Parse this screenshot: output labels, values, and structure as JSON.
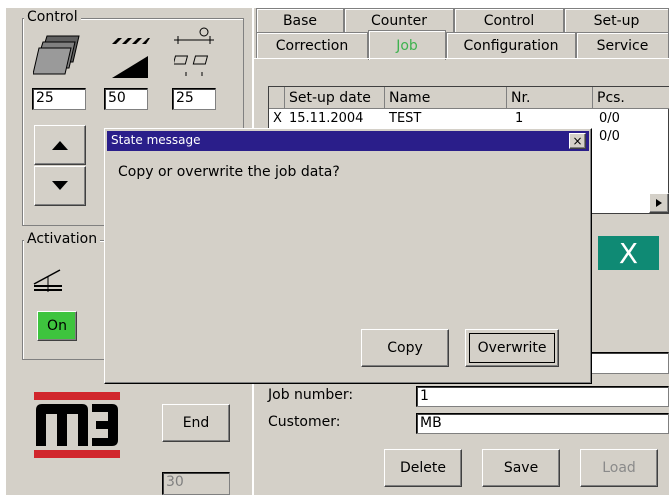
{
  "control": {
    "legend": "Control",
    "values": [
      "25",
      "50",
      "25"
    ]
  },
  "activation": {
    "legend": "Activation",
    "on_label": "On"
  },
  "buttons": {
    "end": "End",
    "counter_field": "30"
  },
  "tabs_row1": [
    "Base",
    "Counter",
    "Control",
    "Set-up"
  ],
  "tabs_row2": [
    "Correction",
    "Job",
    "Configuration",
    "Service"
  ],
  "job_table": {
    "headers": [
      "Set-up date",
      "Name",
      "Nr.",
      "Pcs."
    ],
    "rows": [
      {
        "mark": "X",
        "date": "15.11.2004",
        "name": "TEST",
        "nr": "1",
        "pcs": "0/0"
      },
      {
        "mark": "",
        "date": "",
        "name": "",
        "nr": "",
        "pcs": "0/0"
      }
    ]
  },
  "form": {
    "job_number_label": "Job number:",
    "job_number_value": "1",
    "customer_label": "Customer:",
    "customer_value": "MB"
  },
  "actions": {
    "delete": "Delete",
    "save": "Save",
    "load": "Load"
  },
  "dialog": {
    "title": "State message",
    "close": "×",
    "message": "Copy or overwrite the job data?",
    "copy": "Copy",
    "overwrite": "Overwrite"
  },
  "big_x": "X",
  "logo_text": "m3",
  "colors": {
    "panel": "#d4d0c8",
    "on_button": "#3ec43e",
    "logo_red": "#d1262c",
    "dialog_title": "#2a1e8a",
    "teal": "#0f8a74",
    "active_tab": "#3fb24f"
  }
}
